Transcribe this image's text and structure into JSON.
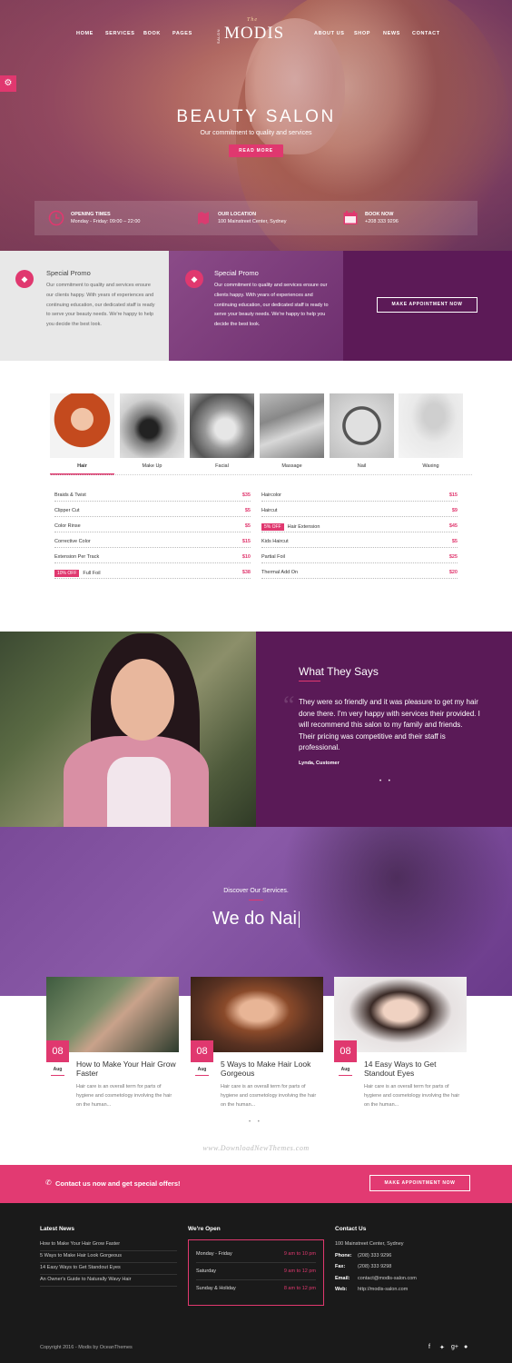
{
  "nav": {
    "left": [
      "HOME",
      "SERVICES",
      "BOOK",
      "PAGES"
    ],
    "right": [
      "ABOUT US",
      "SHOP",
      "NEWS",
      "CONTACT"
    ]
  },
  "logo": {
    "the": "The",
    "salon": "SALON",
    "word": "MODIS"
  },
  "hero": {
    "title": "BEAUTY SALON",
    "subtitle": "Our commitment to quality and services",
    "button": "READ MORE",
    "info": [
      {
        "title": "OPENING TIMES",
        "value": "Monday - Friday: 09:00 – 22:00",
        "icon": "clock-icon"
      },
      {
        "title": "OUR LOCATION",
        "value": "100 Mainstreet Center, Sydney",
        "icon": "map-pin-icon"
      },
      {
        "title": "BOOK NOW",
        "value": "+208 333 9296",
        "icon": "calendar-icon"
      }
    ]
  },
  "promo": [
    {
      "title": "Special Promo",
      "text": "Our commitment to quality and services ensure our clients happy. With years of experiences and continuing education, our dedicated staff is ready to serve your beauty needs. We're happy to help you decide the best look."
    },
    {
      "title": "Special Promo",
      "text": "Our commitment to quality and services ensure our clients happy. With years of experiences and continuing education, our dedicated staff is ready to serve your beauty needs. We're happy to help you decide the best look."
    }
  ],
  "promo_button": "MAKE APPOINTMENT NOW",
  "tabs": [
    "Hair",
    "Make Up",
    "Facial",
    "Massage",
    "Nail",
    "Waxing"
  ],
  "prices_left": [
    {
      "name": "Braids & Twist",
      "price": "$35",
      "tag": ""
    },
    {
      "name": "Clipper Cut",
      "price": "$5",
      "tag": ""
    },
    {
      "name": "Color Rinse",
      "price": "$5",
      "tag": ""
    },
    {
      "name": "Corrective Color",
      "price": "$15",
      "tag": ""
    },
    {
      "name": "Extension Per Track",
      "price": "$10",
      "tag": ""
    },
    {
      "name": "Full Foil",
      "price": "$38",
      "tag": "10% OFF"
    }
  ],
  "prices_right": [
    {
      "name": "Haircolor",
      "price": "$15",
      "tag": ""
    },
    {
      "name": "Haircut",
      "price": "$9",
      "tag": ""
    },
    {
      "name": "Hair Extension",
      "price": "$45",
      "tag": "5% OFF"
    },
    {
      "name": "Kids Haircut",
      "price": "$5",
      "tag": ""
    },
    {
      "name": "Partial Foil",
      "price": "$25",
      "tag": ""
    },
    {
      "name": "Thermal Add On",
      "price": "$20",
      "tag": ""
    }
  ],
  "testimonial": {
    "title": "What They Says",
    "text": "They were so friendly and it was pleasure to get my hair done there. I'm very happy with services their provided. I will recommend this salon to my family and friends. Their pricing was competitive and their staff is professional.",
    "author": "Lynda, Customer",
    "dots": "• •"
  },
  "discover": {
    "subtitle": "Discover Our Services.",
    "title": "We do Nai"
  },
  "posts": [
    {
      "day": "08",
      "month": "Aug",
      "title": "How to Make Your Hair Grow Faster",
      "excerpt": "Hair care is an overall term for parts of hygiene and cosmetology involving the hair on the human..."
    },
    {
      "day": "08",
      "month": "Aug",
      "title": "5 Ways to Make Hair Look Gorgeous",
      "excerpt": "Hair care is an overall term for parts of hygiene and cosmetology involving the hair on the human..."
    },
    {
      "day": "08",
      "month": "Aug",
      "title": "14 Easy Ways to Get Standout Eyes",
      "excerpt": "Hair care is an overall term for parts of hygiene and cosmetology involving the hair on the human..."
    }
  ],
  "post_dots": "• •",
  "watermark": "www.DownloadNewThemes.com",
  "cta": {
    "text": "Contact us now and get special offers!",
    "button": "MAKE APPOINTMENT NOW"
  },
  "footer": {
    "news_title": "Latest News",
    "news": [
      "How to Make Your Hair Grow Faster",
      "5 Ways to Make Hair Look Gorgeous",
      "14 Easy Ways to Get Standout Eyes",
      "An Owner's Guide to Naturally Wavy Hair"
    ],
    "open_title": "We're Open",
    "hours": [
      {
        "day": "Monday - Friday",
        "hours": "9 am to 10 pm"
      },
      {
        "day": "Saturday",
        "hours": "9 am to 12 pm"
      },
      {
        "day": "Sunday & Holiday",
        "hours": "8 am to 12 pm"
      }
    ],
    "contact_title": "Contact Us",
    "address": "100 Mainstreet Center, Sydney",
    "contacts": [
      {
        "label": "Phone:",
        "value": "(208) 333 9296"
      },
      {
        "label": "Fax:",
        "value": "(208) 333 9298"
      },
      {
        "label": "Email:",
        "value": "contact@modis-salon.com"
      },
      {
        "label": "Web:",
        "value": "http://modis-salon.com"
      }
    ],
    "copyright": "Copyright 2016 - Modis by OceanThemes"
  },
  "colors": {
    "accent": "#e0386f",
    "plum": "#5a1a57",
    "footer": "#1a1a1a"
  }
}
